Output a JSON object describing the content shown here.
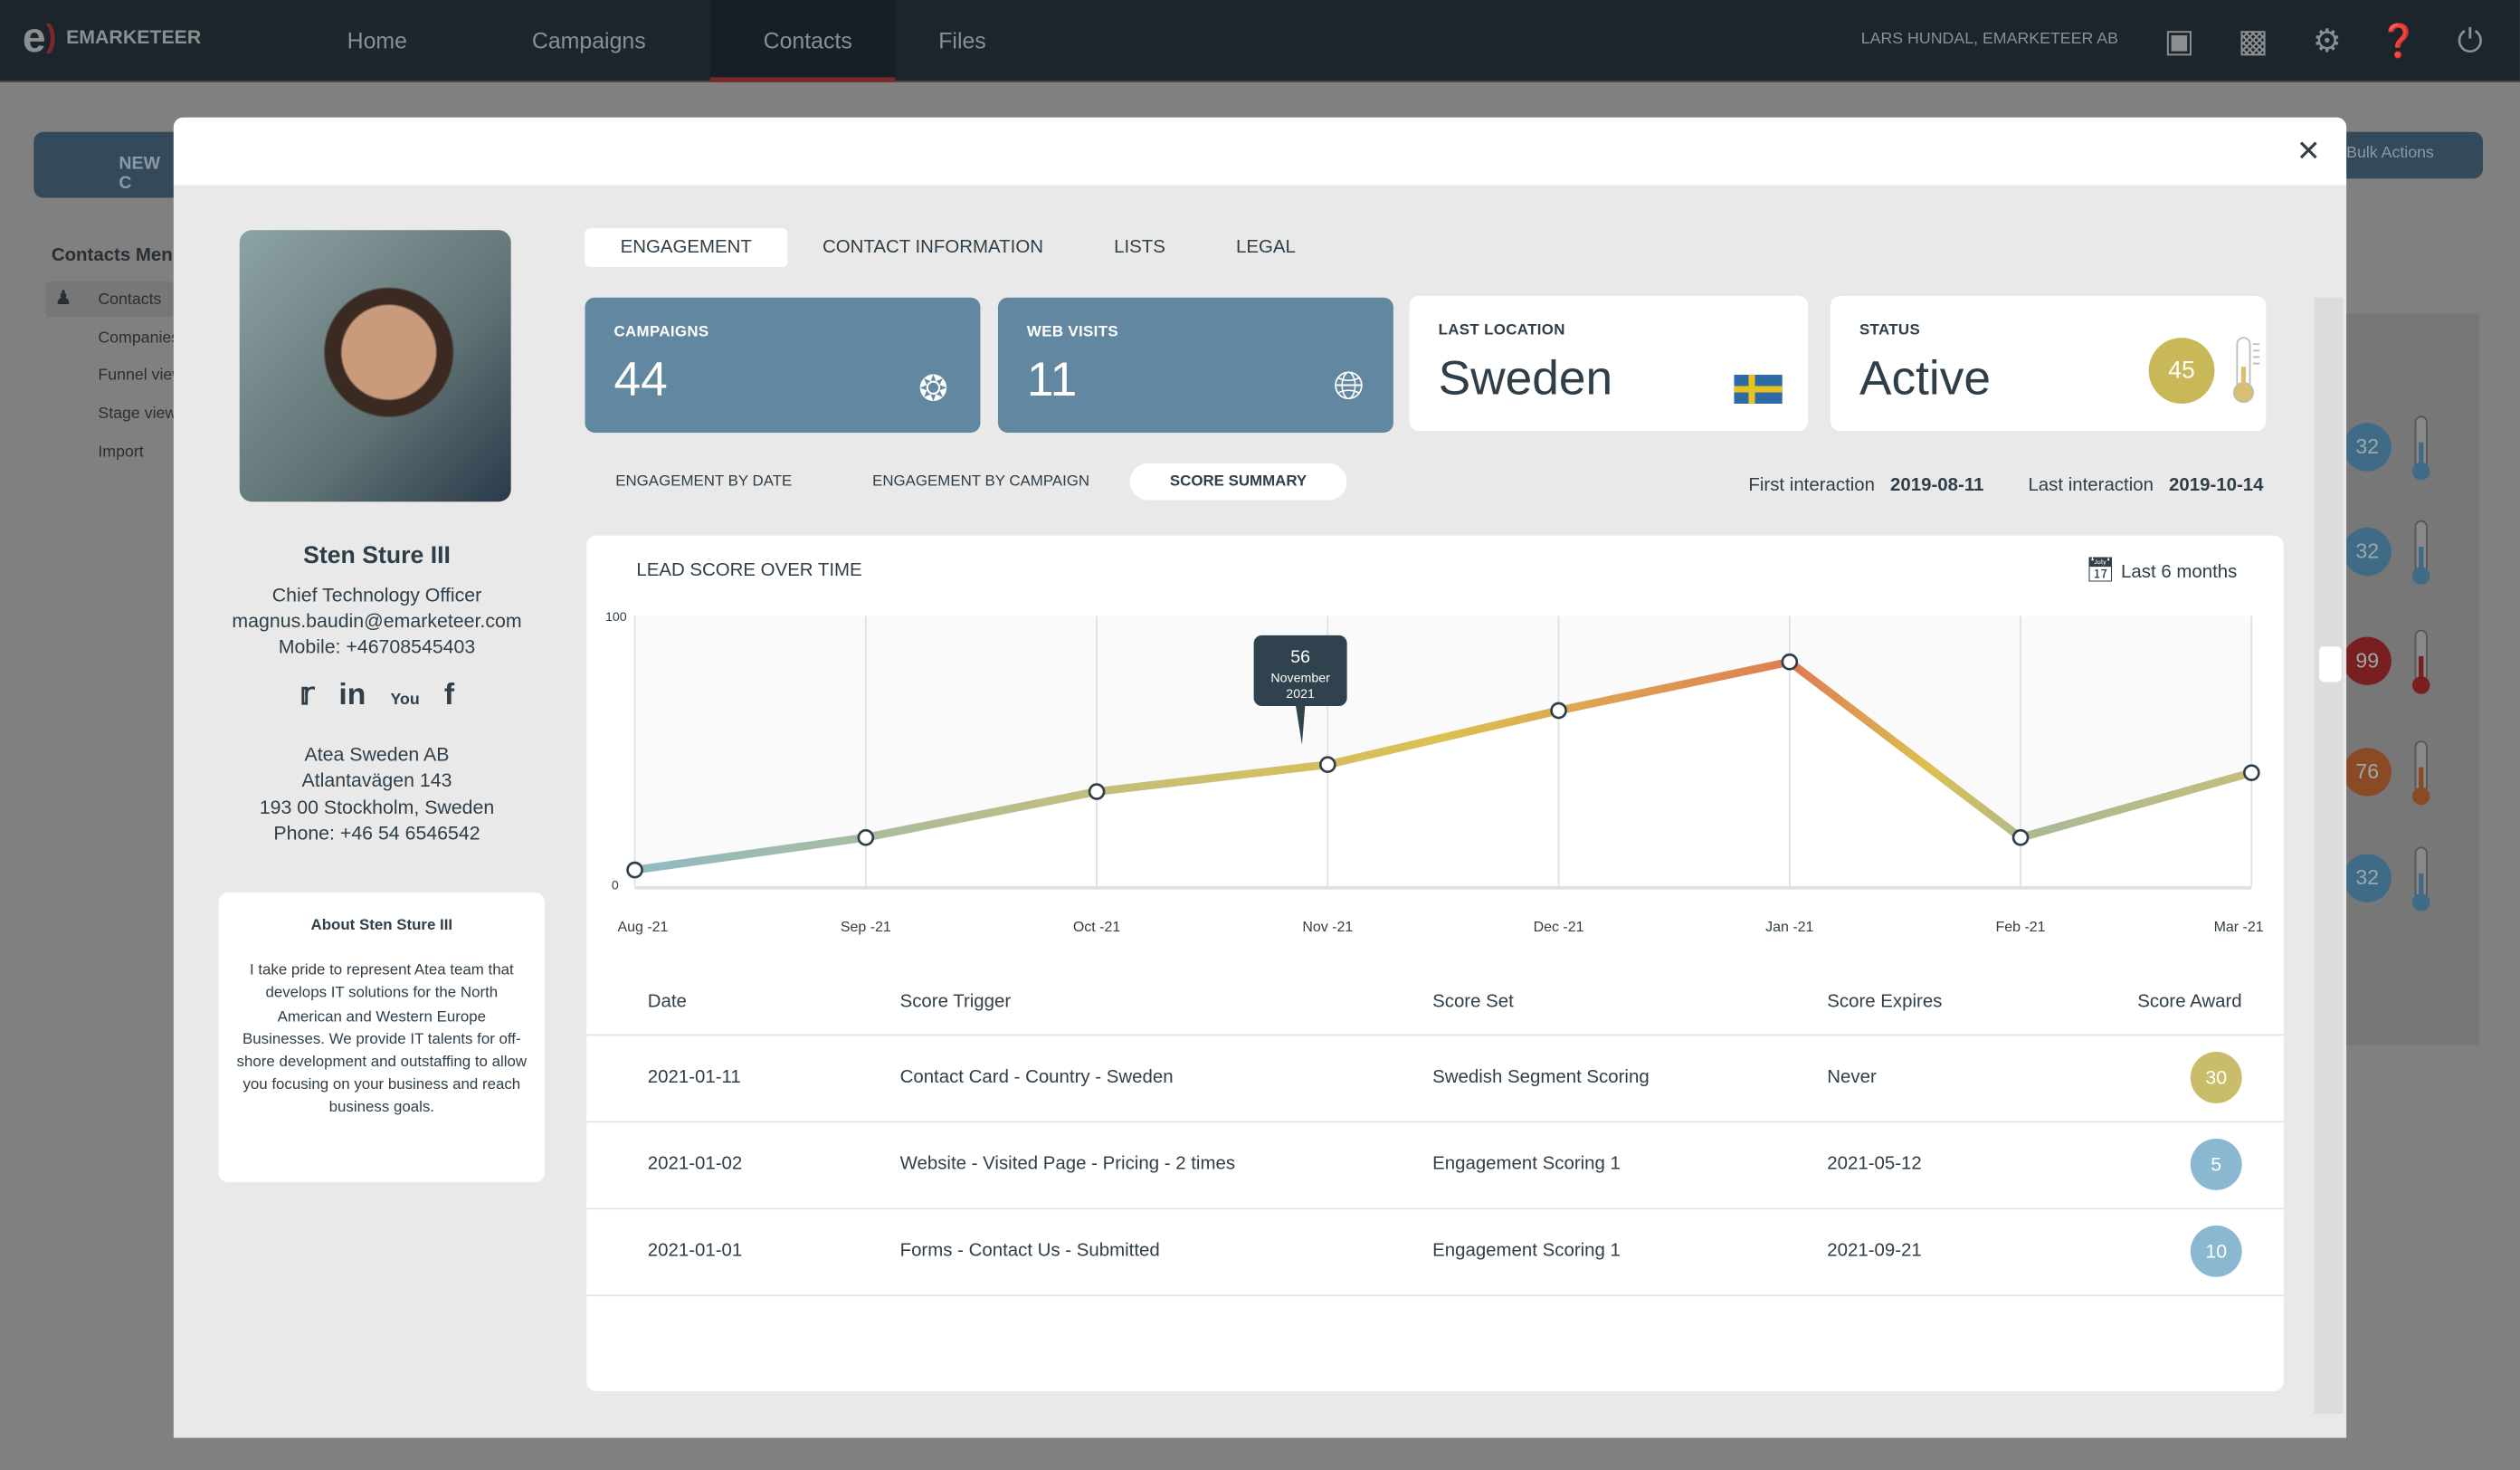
{
  "nav": {
    "brand": "EMARKETEER",
    "items": [
      "Home",
      "Campaigns",
      "Contacts",
      "Files"
    ],
    "active": "Contacts",
    "user": "LARS HUNDAL, EMARKETEER AB"
  },
  "background": {
    "new_button": "NEW C",
    "bulk_actions": "Bulk Actions",
    "menu_title": "Contacts Menu",
    "menu": [
      "Contacts",
      "Companies",
      "Funnel view",
      "Stage view",
      "Import"
    ],
    "scores": [
      {
        "v": "32",
        "c": "#3f6b86"
      },
      {
        "v": "32",
        "c": "#3f6b86"
      },
      {
        "v": "99",
        "c": "#7a1f1f"
      },
      {
        "v": "76",
        "c": "#8a4a25"
      },
      {
        "v": "32",
        "c": "#3f6b86"
      }
    ]
  },
  "profile": {
    "name": "Sten Sture III",
    "title": "Chief Technology Officer",
    "email": "magnus.baudin@emarketeer.com",
    "mobile": "Mobile: +46708545403",
    "company": "Atea Sweden AB",
    "street": "Atlantavägen 143",
    "city": "193 00 Stockholm, Sweden",
    "phone": "Phone: +46 54 6546542",
    "social": [
      "twitter",
      "linkedin",
      "youtube",
      "facebook"
    ],
    "about_title": "About Sten Sture III",
    "about": "I take pride to represent Atea team that develops IT solutions for the North American and Western Europe Businesses. We provide IT talents for off-shore development and outstaffing to allow you focusing on your business and reach business goals."
  },
  "tabs": [
    "ENGAGEMENT",
    "CONTACT INFORMATION",
    "LISTS",
    "LEGAL"
  ],
  "kpis": {
    "campaigns_label": "CAMPAIGNS",
    "campaigns": "44",
    "visits_label": "WEB VISITS",
    "visits": "11",
    "location_label": "LAST LOCATION",
    "location": "Sweden",
    "status_label": "STATUS",
    "status": "Active",
    "score": "45",
    "score_color": "#c9b857"
  },
  "subtabs": [
    "ENGAGEMENT BY DATE",
    "ENGAGEMENT BY CAMPAIGN",
    "SCORE SUMMARY"
  ],
  "interaction": {
    "first_label": "First interaction",
    "first": "2019-08-11",
    "last_label": "Last interaction",
    "last": "2019-10-14"
  },
  "chart_data": {
    "type": "line",
    "title": "LEAD SCORE OVER TIME",
    "range_label": "Last 6 months",
    "categories": [
      "Aug -21",
      "Sep -21",
      "Oct -21",
      "Nov -21",
      "Dec -21",
      "Jan -21",
      "Feb -21",
      "Mar -21"
    ],
    "values": [
      6,
      18,
      35,
      45,
      65,
      83,
      18,
      42
    ],
    "ylim": [
      0,
      100
    ],
    "yticks": [
      "0",
      "100"
    ],
    "grid": "vertical",
    "tooltip": {
      "value": "56",
      "label1": "November",
      "label2": "2021"
    }
  },
  "table": {
    "headers": [
      "Date",
      "Score Trigger",
      "Score Set",
      "Score Expires",
      "Score Award"
    ],
    "rows": [
      {
        "date": "2021-01-11",
        "trigger": "Contact Card - Country - Sweden",
        "set": "Swedish Segment Scoring",
        "expires": "Never",
        "award": "30",
        "color": "#c9bd6a"
      },
      {
        "date": "2021-01-02",
        "trigger": "Website - Visited Page - Pricing - 2 times",
        "set": "Engagement Scoring 1",
        "expires": "2021-05-12",
        "award": "5",
        "color": "#8ab8d0"
      },
      {
        "date": "2021-01-01",
        "trigger": "Forms - Contact Us - Submitted",
        "set": "Engagement Scoring 1",
        "expires": "2021-09-21",
        "award": "10",
        "color": "#8ab8d0"
      }
    ]
  }
}
